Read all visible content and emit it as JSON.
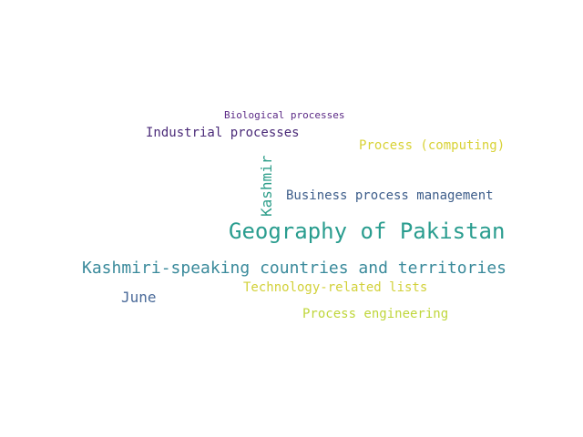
{
  "words": [
    {
      "text": "Biological processes",
      "color": "#5b2a86"
    },
    {
      "text": "Industrial processes",
      "color": "#4a2a78"
    },
    {
      "text": "Process (computing)",
      "color": "#d8d236"
    },
    {
      "text": "Kashmir",
      "color": "#2e9e8a"
    },
    {
      "text": "Business process management",
      "color": "#3d5d8a"
    },
    {
      "text": "Geography of Pakistan",
      "color": "#2a9d8f"
    },
    {
      "text": "Kashmiri-speaking countries and territories",
      "color": "#3a8a9b"
    },
    {
      "text": "June",
      "color": "#4a6a99"
    },
    {
      "text": "Technology-related lists",
      "color": "#d2d13a"
    },
    {
      "text": "Process engineering",
      "color": "#bfd63a"
    }
  ]
}
